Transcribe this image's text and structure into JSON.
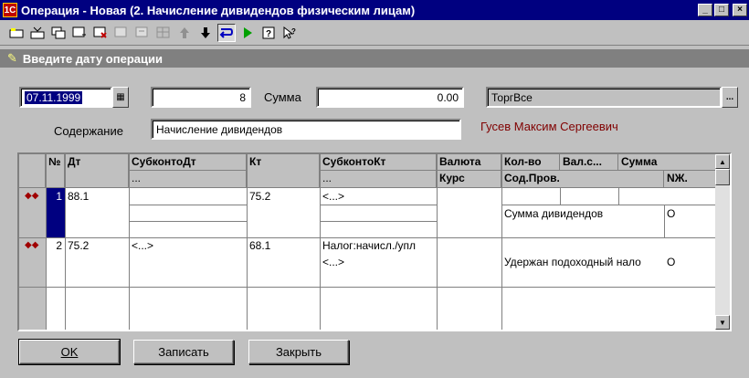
{
  "window": {
    "title": "Операция - Новая (2. Начисление дивидендов  физическим лицам)",
    "app_icon": "1c-icon",
    "controls": [
      "_",
      "□",
      "×"
    ]
  },
  "toolbar": {
    "icons": [
      "new-row-icon",
      "insert-row-icon",
      "copy-row-icon",
      "add-row-icon",
      "delete-row-icon",
      "edit-row-icon",
      "edit-row2-icon",
      "grid-icon",
      "move-up-icon",
      "move-down-icon",
      "redirect-icon",
      "run-icon",
      "help-icon",
      "context-help-icon"
    ]
  },
  "hint": {
    "text": "Введите дату операции"
  },
  "form": {
    "date": "07.11.1999",
    "number": "8",
    "sum_label": "Сумма",
    "sum": "0.00",
    "firm": "ТоргВсе",
    "content_label": "Содержание",
    "content": "Начисление дивидендов",
    "person": "Гусев Максим Сергеевич"
  },
  "grid": {
    "headers": {
      "num": "№",
      "dt": "Дт",
      "subkonto_dt": "СубконтоДт",
      "subkonto_dt_sub": "...",
      "kt": "Кт",
      "subkonto_kt": "СубконтоКт",
      "subkonto_kt_sub": "...",
      "currency": "Валюта",
      "rate": "Курс",
      "qty": "Кол-во",
      "val_sum": "Вал.с...",
      "sum": "Сумма",
      "content": "Сод.Пров.",
      "journal": "NЖ."
    },
    "rows": [
      {
        "num": "1",
        "dt": "88.1",
        "subkonto_dt": "",
        "kt": "75.2",
        "subkonto_kt": "<...>",
        "content": "Сумма дивидендов",
        "journal": "О"
      },
      {
        "num": "2",
        "dt": "75.2",
        "subkonto_dt": "<...>",
        "kt": "68.1",
        "subkonto_kt": "Налог:начисл./упл",
        "subkonto_kt2": "<...>",
        "content": "Удержан подоходный нало",
        "journal": "О"
      }
    ]
  },
  "buttons": {
    "ok": "OK",
    "save": "Записать",
    "close": "Закрыть"
  }
}
